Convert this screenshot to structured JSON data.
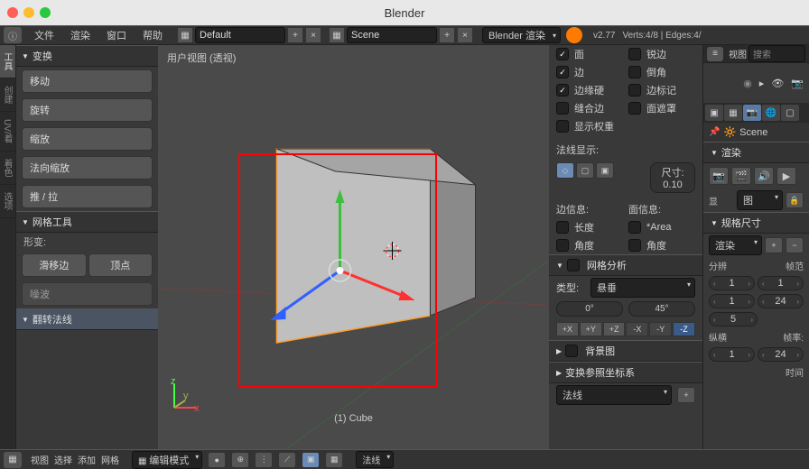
{
  "app_title": "Blender",
  "menubar": {
    "items": [
      "文件",
      "渲染",
      "窗口",
      "帮助"
    ],
    "layout": "Default",
    "scene": "Scene",
    "engine": "Blender 渲染",
    "version": "v2.77",
    "stats": "Verts:4/8 | Edges:4/"
  },
  "left_tabs": [
    "工具",
    "创建",
    "UV/着",
    "着色",
    "选项"
  ],
  "tool_panel": {
    "transform": {
      "title": "变换",
      "items": [
        "移动",
        "旋转",
        "缩放",
        "法向缩放",
        "推 / 拉"
      ]
    },
    "mesh_tools": {
      "title": "网格工具",
      "deform_label": "形变:",
      "slide": "滑移边",
      "vertex": "顶点",
      "noise": "噪波"
    },
    "flip_normals": {
      "title": "翻转法线"
    }
  },
  "viewport": {
    "label": "用户视图 (透视)",
    "object": "(1) Cube"
  },
  "npanel": {
    "checks": [
      {
        "label": "面",
        "on": true
      },
      {
        "label": "锐边",
        "on": false
      },
      {
        "label": "边",
        "on": true
      },
      {
        "label": "倒角",
        "on": false
      },
      {
        "label": "边缘硬",
        "on": true
      },
      {
        "label": "边标记",
        "on": false
      },
      {
        "label": "缝合边",
        "on": false
      },
      {
        "label": "面遮罩",
        "on": false
      },
      {
        "label": "显示权重",
        "on": false
      }
    ],
    "normals_label": "法线显示:",
    "size_label": "尺寸:",
    "size_val": "0.10",
    "edge_info": "边信息:",
    "face_info": "面信息:",
    "length": "长度",
    "area": "*Area",
    "angle1": "角度",
    "angle2": "角度",
    "mesh_analysis": "网格分析",
    "type_label": "类型:",
    "type_val": "悬垂",
    "deg0": "0°",
    "deg45": "45°",
    "bg_image": "背景图",
    "transform_orient": "变换参照坐标系",
    "orient_val": "法线"
  },
  "outliner": {
    "view": "视图",
    "search": "搜索"
  },
  "properties": {
    "scene_label": "Scene",
    "render_header": "渲染",
    "display_label": "显",
    "dimensions_header": "规格尺寸",
    "render_preset": "渲染",
    "resolution_label": "分辨",
    "frame_range_label": "帧范",
    "res_x": "1",
    "res_y": "1",
    "res_pct": "5",
    "frame_start": "1",
    "frame_end": "24",
    "aspect_label": "纵横",
    "fps_label": "帧率:",
    "aspect_x": "1",
    "fps": "24",
    "time_label": "时间"
  },
  "bottom": {
    "items": [
      "视图",
      "选择",
      "添加",
      "网格"
    ],
    "mode": "编辑模式",
    "shading": "法线"
  }
}
